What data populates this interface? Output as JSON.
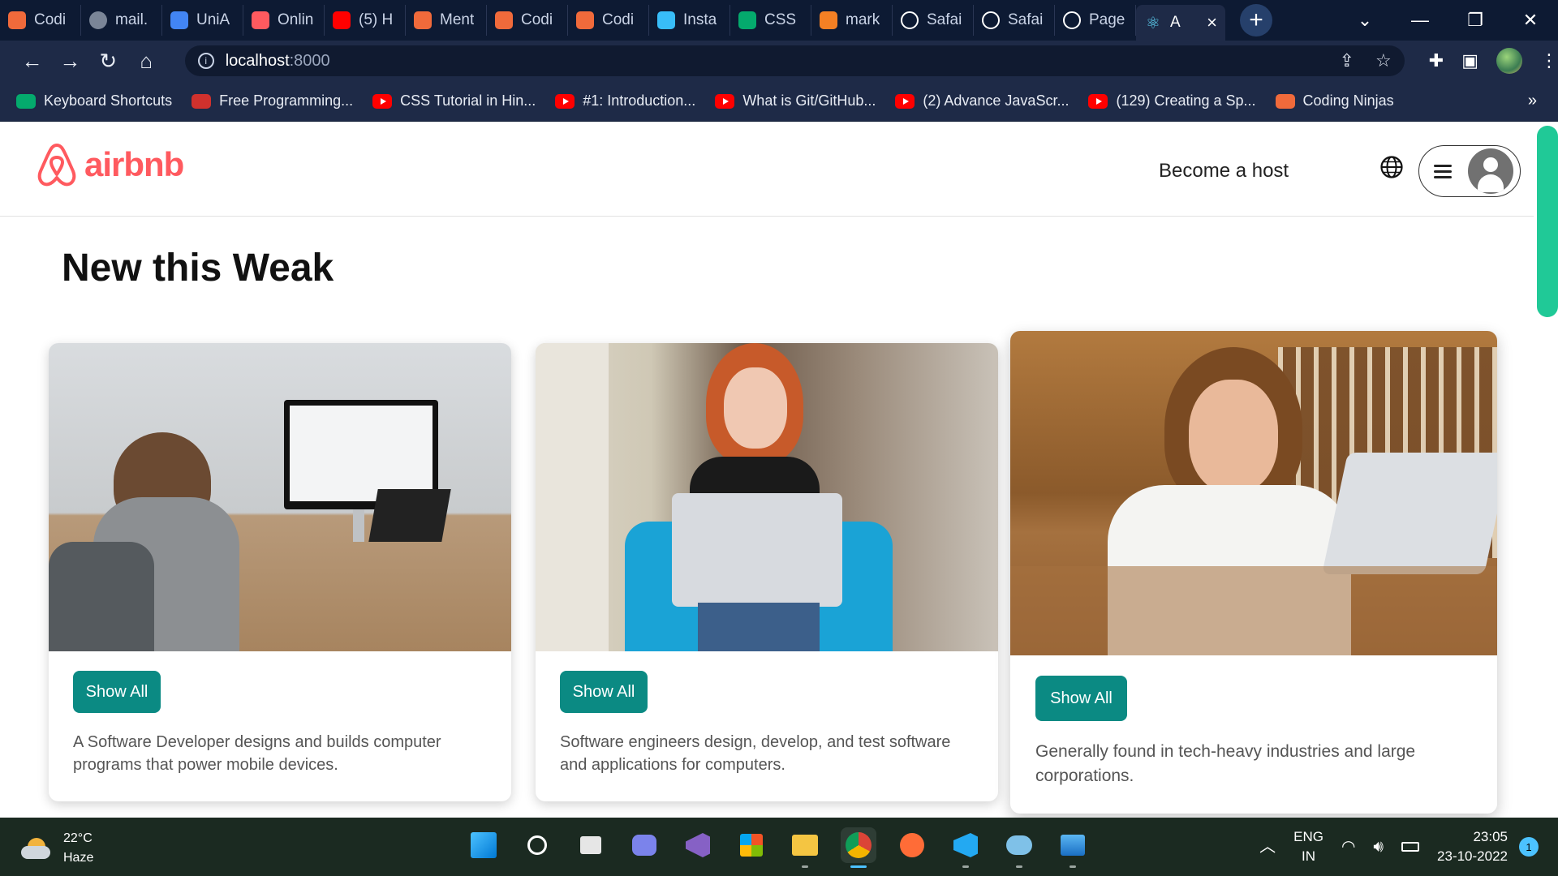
{
  "browser": {
    "tabs": [
      {
        "label": "Codi",
        "favicon": "coding-ninjas-icon",
        "color": "#f06a3b"
      },
      {
        "label": "mail.",
        "favicon": "globe-icon",
        "color": "#7a8597"
      },
      {
        "label": "UniA",
        "favicon": "docs-icon",
        "color": "#4285f4"
      },
      {
        "label": "Onlin",
        "favicon": "airbnb-icon",
        "color": "#ff5a5f"
      },
      {
        "label": "(5) H",
        "favicon": "youtube-icon",
        "color": "#ff0000"
      },
      {
        "label": "Ment",
        "favicon": "coding-ninjas-icon",
        "color": "#f06a3b"
      },
      {
        "label": "Codi",
        "favicon": "coding-ninjas-icon",
        "color": "#f06a3b"
      },
      {
        "label": "Codi",
        "favicon": "coding-ninjas-icon",
        "color": "#f06a3b"
      },
      {
        "label": "Insta",
        "favicon": "tailwind-icon",
        "color": "#38bdf8"
      },
      {
        "label": "CSS",
        "favicon": "w3schools-icon",
        "color": "#04aa6d"
      },
      {
        "label": "mark",
        "favicon": "stackoverflow-icon",
        "color": "#f48024"
      },
      {
        "label": "Safai",
        "favicon": "github-icon",
        "color": "#ffffff"
      },
      {
        "label": "Safai",
        "favicon": "github-icon",
        "color": "#ffffff"
      },
      {
        "label": "Page",
        "favicon": "github-icon",
        "color": "#ffffff"
      }
    ],
    "active_tab": {
      "label": "A",
      "favicon": "react-icon",
      "color": "#61dafb"
    },
    "address": {
      "host": "localhost",
      "port": ":8000"
    },
    "bookmarks": [
      {
        "label": "Keyboard Shortcuts",
        "icon": "w3schools-icon"
      },
      {
        "label": "Free Programming...",
        "icon": "my-icon"
      },
      {
        "label": "CSS Tutorial in Hin...",
        "icon": "youtube-icon"
      },
      {
        "label": "#1: Introduction...",
        "icon": "youtube-icon"
      },
      {
        "label": "What is Git/GitHub...",
        "icon": "youtube-icon"
      },
      {
        "label": "(2) Advance JavaScr...",
        "icon": "youtube-icon"
      },
      {
        "label": "(129) Creating a Sp...",
        "icon": "youtube-icon"
      },
      {
        "label": "Coding Ninjas",
        "icon": "coding-ninjas-icon"
      }
    ],
    "bookmarks_more": "»"
  },
  "site": {
    "logo_text": "airbnb",
    "brand_color": "#ff5a5f",
    "become_host": "Become a host",
    "section_title": "New this Weak",
    "cards": [
      {
        "button": "Show All",
        "description_lines": [
          "A Software Developer designs and builds computer",
          "programs that power mobile devices."
        ]
      },
      {
        "button": "Show All",
        "description_lines": [
          "Software engineers design, develop, and test software",
          "and applications for computers."
        ]
      },
      {
        "button": "Show All",
        "description_lines": [
          "Generally found in tech-heavy industries and large",
          "corporations."
        ]
      }
    ],
    "button_color": "#0b8a83",
    "scrollbar_color": "#20c997"
  },
  "taskbar": {
    "weather": {
      "temp": "22°C",
      "condition": "Haze"
    },
    "apps": [
      "windows-start-icon",
      "search-icon",
      "task-view-icon",
      "chat-icon",
      "visual-studio-icon",
      "store-icon",
      "file-explorer-icon",
      "chrome-icon",
      "postman-icon",
      "vscode-icon",
      "azure-data-studio-icon",
      "photos-icon"
    ],
    "language": [
      "ENG",
      "IN"
    ],
    "time": "23:05",
    "date": "23-10-2022",
    "notifications": "1"
  }
}
